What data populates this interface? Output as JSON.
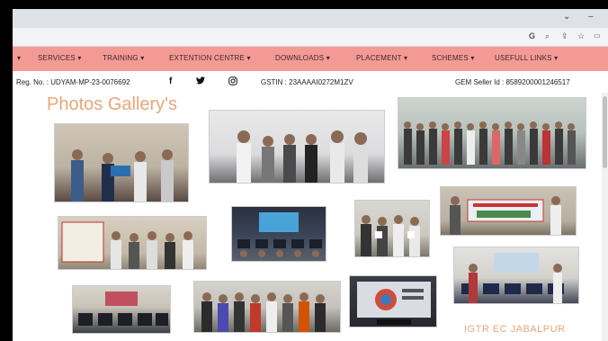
{
  "nav": {
    "items": [
      {
        "label": "SERVICES",
        "arrow": "▾"
      },
      {
        "label": "TRAINING",
        "arrow": "▾"
      },
      {
        "label": "EXTENTION CENTRE",
        "arrow": "▾"
      },
      {
        "label": "DOWNLOADS",
        "arrow": "▾"
      },
      {
        "label": "PLACEMENT",
        "arrow": "▾"
      },
      {
        "label": "SCHEMES",
        "arrow": "▾"
      },
      {
        "label": "USEFULL LINKS",
        "arrow": "▾"
      }
    ],
    "leading_arrow": "▾"
  },
  "info": {
    "reg_no": "Reg. No. : UDYAM-MP-23-0076692",
    "gstin": "GSTIN : 23AAAAI0272M1ZV",
    "gem_seller": "GEM Seller Id : 8589200001246517"
  },
  "gallery": {
    "title": "Photos Gallery's",
    "footer_label": "IGTR EC JABALPUR"
  },
  "colors": {
    "nav_bg": "#f49a95",
    "title_color": "#e8a77c"
  }
}
